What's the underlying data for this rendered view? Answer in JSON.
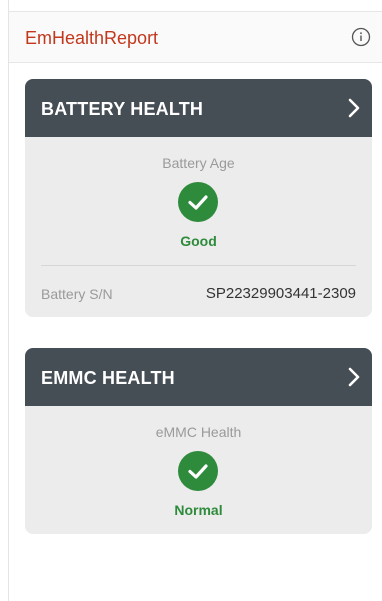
{
  "app_bar": {
    "title": "EmHealthReport",
    "info_icon": "info-circle-icon"
  },
  "battery_card": {
    "title": "BATTERY HEALTH",
    "metric_label": "Battery Age",
    "status": "Good",
    "status_icon": "check-circle-icon",
    "serial_label": "Battery S/N",
    "serial_value": "SP22329903441-2309"
  },
  "emmc_card": {
    "title": "EMMC HEALTH",
    "metric_label": "eMMC Health",
    "status": "Normal",
    "status_icon": "check-circle-icon"
  },
  "colors": {
    "brand": "#c2381d",
    "card_header": "#454d55",
    "card_body": "#ececec",
    "status_good": "#2e8b3c"
  }
}
